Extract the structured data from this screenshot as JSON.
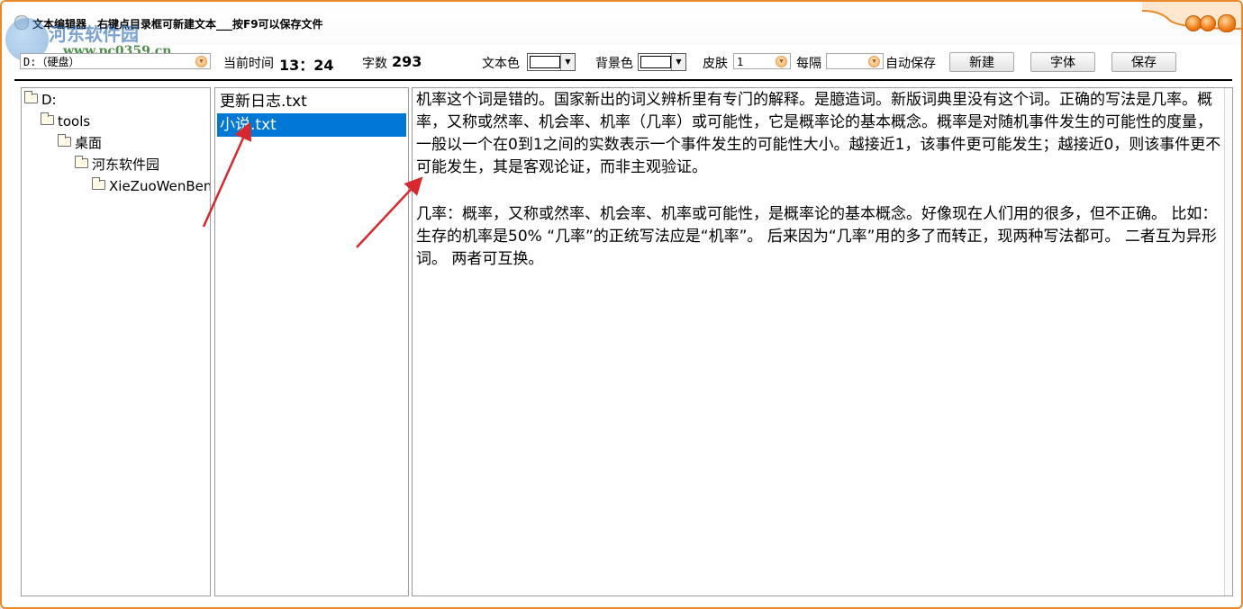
{
  "window": {
    "title": "文本编辑器　右键点目录框可新建文本___按F9可以保存文件"
  },
  "watermark": {
    "name": "河东软件园",
    "url": "www.pc0359.cn"
  },
  "toolbar": {
    "drive_select": "D:（硬盘）",
    "time_label": "当前时间",
    "time_value": "13：24",
    "count_label": "字数",
    "count_value": "293",
    "text_color_label": "文本色",
    "bg_color_label": "背景色",
    "skin_label": "皮肤",
    "skin_value": "1",
    "interval_label": "每隔",
    "interval_value": "",
    "autosave_label": "自动保存",
    "new_label": "新建",
    "font_label": "字体",
    "save_label": "保存"
  },
  "tree": {
    "items": [
      {
        "label": "D:"
      },
      {
        "label": "tools"
      },
      {
        "label": "桌面"
      },
      {
        "label": "河东软件园"
      },
      {
        "label": "XieZuoWenBen"
      }
    ]
  },
  "files": {
    "items": [
      {
        "label": "更新日志.txt",
        "selected": false
      },
      {
        "label": "小说.txt",
        "selected": true
      }
    ]
  },
  "editor": {
    "paragraphs": [
      "机率这个词是错的。国家新出的词义辨析里有专门的解释。是臆造词。新版词典里没有这个词。正确的写法是几率。概率，又称或然率、机会率、机率（几率）或可能性，它是概率论的基本概念。概率是对随机事件发生的可能性的度量，一般以一个在0到1之间的实数表示一个事件发生的可能性大小。越接近1，该事件更可能发生；越接近0，则该事件更不可能发生，其是客观论证，而非主观验证。",
      "几率：概率，又称或然率、机会率、机率或可能性，是概率论的基本概念。好像现在人们用的很多，但不正确。 比如： 生存的机率是50% “几率”的正统写法应是“机率”。 后来因为“几率”用的多了而转正，现两种写法都可。 二者互为异形词。 两者可互换。"
    ]
  },
  "colors": {
    "window_border": "#e88a2c",
    "selection": "#0078d7",
    "annotation_arrow": "#d9272e"
  }
}
